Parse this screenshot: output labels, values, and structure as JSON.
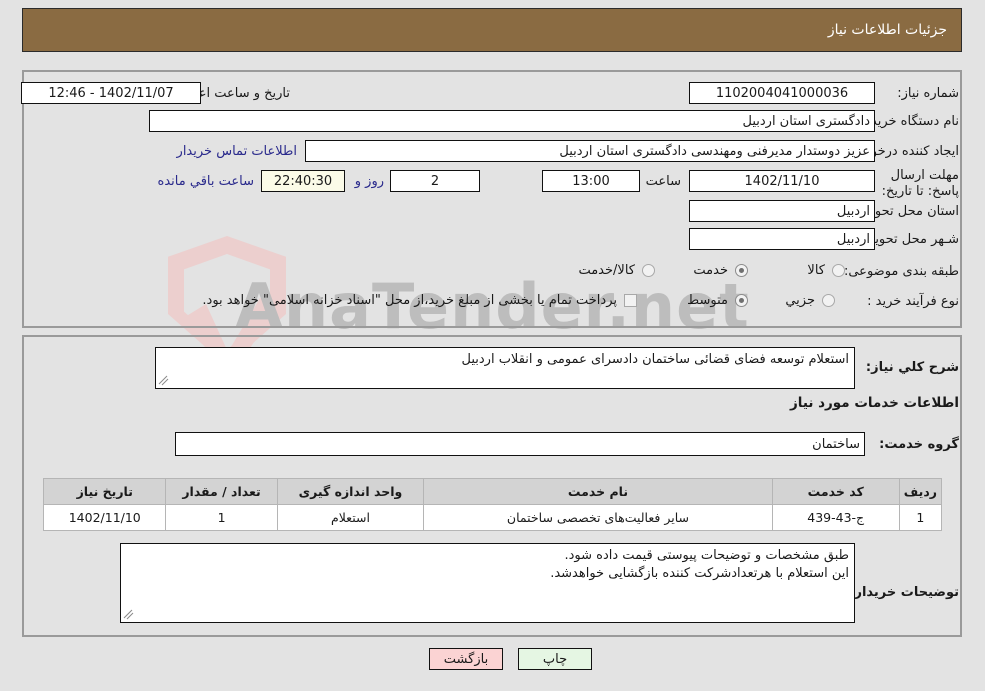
{
  "header": {
    "title": "جزئیات اطلاعات نیاز"
  },
  "watermark": {
    "text": "AnaTender.net"
  },
  "form": {
    "need_number_label": "شماره نیاز:",
    "need_number_value": "1102004041000036",
    "announce_datetime_label": "تاریخ و ساعت اعلان عمومي:",
    "announce_datetime_value": "1402/11/07 - 12:46",
    "buyer_org_label": "نام دستگاه خریدار:",
    "buyer_org_value": "دادگستری استان اردبیل",
    "creator_label": "ایجاد کننده درخواست:",
    "creator_value": "عزیز دوستدار مدیرفنی ومهندسی  دادگستری استان اردبیل",
    "contact_link": "اطلاعات تماس خریدار",
    "deadline_label": "مهلت ارسال پاسخ: تا تاریخ:",
    "deadline_date": "1402/11/10",
    "deadline_hour_label": "ساعت",
    "deadline_hour_value": "13:00",
    "days_value": "2",
    "days_unit_label": "روز و",
    "remaining_value": "22:40:30",
    "remaining_label": "ساعت باقي مانده",
    "province_label": "استان محل تحویل:",
    "province_value": "اردبیل",
    "city_label": "شـهر محل تحویل:",
    "city_value": "اردبیل",
    "category_label": "طبقه بندی موضوعی:",
    "category_options": [
      {
        "label": "کالا",
        "selected": false
      },
      {
        "label": "خدمت",
        "selected": true
      },
      {
        "label": "کالا/خدمت",
        "selected": false
      }
    ],
    "process_label": "نوع فرآیند خرید :",
    "process_options": [
      {
        "label": "جزیي",
        "selected": false
      },
      {
        "label": "متوسط",
        "selected": true
      }
    ],
    "treasury_checkbox_label": "پرداخت تمام یا بخشی از مبلغ خرید،از محل \"اسناد خزانه اسلامی\" خواهد بود.",
    "treasury_checked": false
  },
  "description": {
    "label": "شرح کلي نیاز:",
    "value": "استعلام توسعه فضای قضائی ساختمان دادسرای عمومی و انقلاب اردبیل"
  },
  "services_section": {
    "heading": "اطلاعات خدمات مورد نیاز",
    "group_label": "گروه خدمت:",
    "group_value": "ساختمان"
  },
  "table": {
    "headers": [
      "ردیف",
      "کد خدمت",
      "نام خدمت",
      "واحد اندازه گیری",
      "تعداد / مقدار",
      "تاریخ نیاز"
    ],
    "rows": [
      [
        "1",
        "ج-43-439",
        "سایر فعالیت‌های تخصصی ساختمان",
        "استعلام",
        "1",
        "1402/11/10"
      ]
    ]
  },
  "buyer_notes": {
    "label": "توضیحات خریدار:",
    "line1": "طبق مشخصات و توضیحات پیوستی قیمت داده شود.",
    "line2": "این استعلام با هرتعدادشرکت کننده بازگشایی خواهدشد."
  },
  "buttons": {
    "back": "بازگشت",
    "print": "چاپ"
  }
}
